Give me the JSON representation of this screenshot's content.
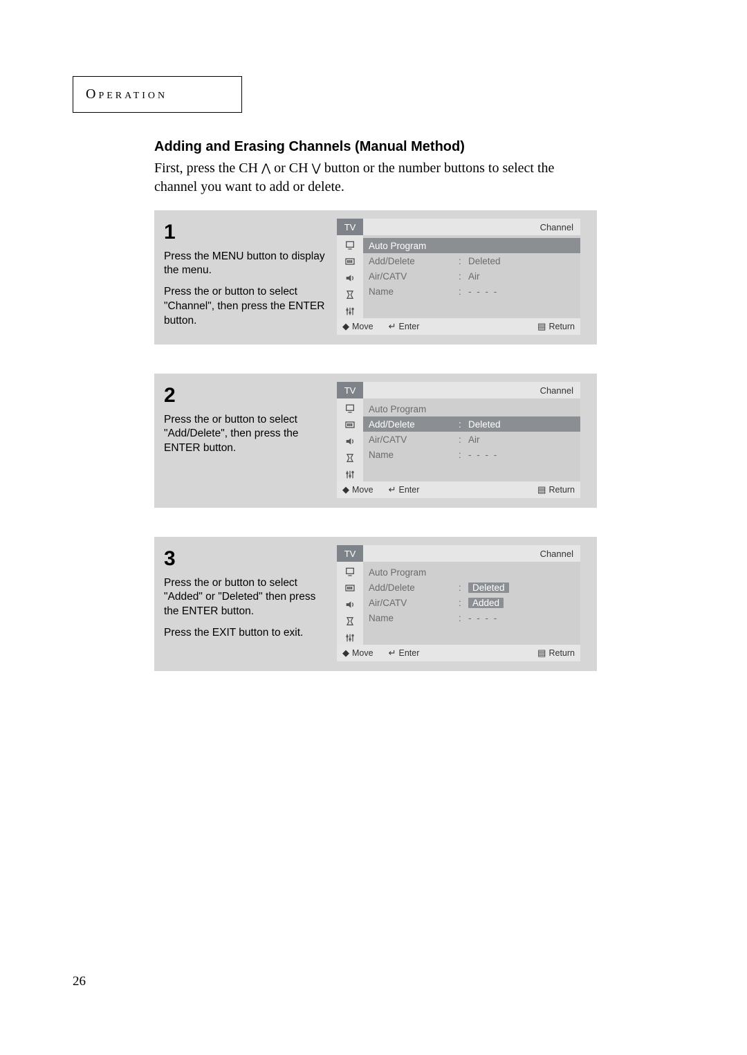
{
  "section_label": "Operation",
  "heading": "Adding and Erasing Channels (Manual Method)",
  "intro_a": "First, press the CH ",
  "intro_b": " or CH ",
  "intro_c": " button or the number buttons to select the channel you want to add or delete.",
  "page_number": "26",
  "footer": {
    "move": "Move",
    "enter": "Enter",
    "return": "Return"
  },
  "tv_tab": "TV",
  "tv_title": "Channel",
  "menu_labels": {
    "auto": "Auto Program",
    "add": "Add/Delete",
    "air": "Air/CATV",
    "name": "Name"
  },
  "values": {
    "deleted": "Deleted",
    "air": "Air",
    "added": "Added",
    "dashes": "- - - -"
  },
  "steps": {
    "1": {
      "num": "1",
      "lines": [
        "Press the MENU button to display the menu.",
        "Press the   or   button to select \"Channel\", then press the ENTER button."
      ]
    },
    "2": {
      "num": "2",
      "lines": [
        "Press the   or   button to select \"Add/Delete\", then press the ENTER button."
      ]
    },
    "3": {
      "num": "3",
      "lines": [
        "Press the   or   button to select \"Added\" or \"Deleted\" then press the ENTER button.",
        "Press the EXIT button to exit."
      ]
    }
  }
}
